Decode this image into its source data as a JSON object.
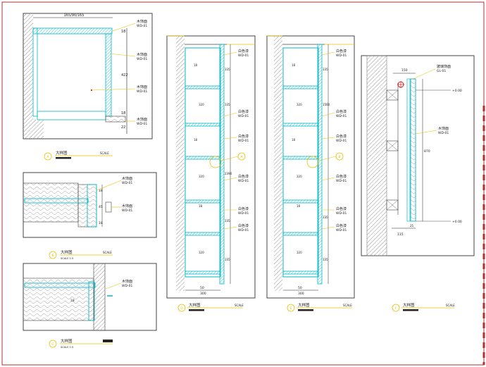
{
  "colors": {
    "border": "#b03030",
    "panel": "#444444",
    "cyan": "#00b8c8",
    "yellow": "#e8c000",
    "red": "#d00000",
    "dim": "#222222",
    "wall": "#999999"
  },
  "detail_a": {
    "top_dim": "165/90/165",
    "side_dims": [
      "18",
      "422",
      "18",
      "22"
    ],
    "notes": [
      {
        "title": "木饰面",
        "code": "WD-01"
      },
      {
        "title": "木饰面",
        "code": "WD-01"
      },
      {
        "title": "木饰面",
        "code": "WD-01"
      },
      {
        "title": "木饰面",
        "code": "WD-01"
      }
    ],
    "label": {
      "marker": "A",
      "title": "大样图",
      "scale": "SCALE"
    }
  },
  "detail_b": {
    "notes": [
      {
        "title": "木饰面",
        "code": "WD-01"
      },
      {
        "title": "木饰面",
        "code": "WD-01"
      }
    ],
    "side_dims": [
      "18",
      "45",
      "18"
    ],
    "label": {
      "marker": "B",
      "title": "大样图",
      "sub": "SCALE 1:5",
      "scale": "SCALE"
    }
  },
  "detail_c": {
    "notes": [
      {
        "title": "木饰面",
        "code": "WD-01"
      }
    ],
    "side_dims": [
      "18"
    ],
    "label": {
      "marker": "C",
      "title": "大样图",
      "sub": "SCALE 1:5",
      "scale": "SCALE"
    }
  },
  "elevation_1": {
    "shelf_dims": [
      "18",
      "320",
      "18",
      "320",
      "18",
      "320",
      "18",
      "320",
      "18",
      "320",
      "18"
    ],
    "right_dims": [
      "335",
      "335",
      "2390",
      "335",
      "335"
    ],
    "bottom_dims": [
      "50",
      "300"
    ],
    "notes": [
      {
        "title": "白色漆",
        "code": "WD-01"
      },
      {
        "title": "白色漆",
        "code": "WD-01"
      },
      {
        "title": "白色漆",
        "code": "WD-01"
      },
      {
        "title": "白色漆",
        "code": "WD-01"
      },
      {
        "title": "白色漆",
        "code": "WD-01"
      },
      {
        "title": "白色漆",
        "code": "WD-01"
      }
    ],
    "callout": "A",
    "label": {
      "marker": "D",
      "title": "大样图",
      "scale": "SCALE"
    }
  },
  "elevation_2": {
    "shelf_dims": [
      "18",
      "320",
      "18",
      "320",
      "18",
      "320",
      "18",
      "320",
      "18",
      "320",
      "18"
    ],
    "right_dims": [
      "335",
      "1560",
      "335",
      "335"
    ],
    "bottom_dims": [
      "50",
      "300"
    ],
    "notes": [
      {
        "title": "白色漆",
        "code": "WD-01"
      },
      {
        "title": "白色漆",
        "code": "WD-01"
      },
      {
        "title": "白色漆",
        "code": "WD-01"
      },
      {
        "title": "白色漆",
        "code": "WD-01"
      },
      {
        "title": "白色漆",
        "code": "WD-01"
      },
      {
        "title": "白色漆",
        "code": "WD-01"
      }
    ],
    "callout": "B",
    "label": {
      "marker": "E",
      "title": "大样图",
      "scale": "SCALE"
    }
  },
  "section_f": {
    "top_dim": "150",
    "right_dim": "870",
    "bottom_dims": [
      "115",
      "25"
    ],
    "notes": [
      {
        "title": "玻璃饰面",
        "code": "GL-01"
      },
      {
        "title": "木饰面",
        "code": "WD-01"
      }
    ],
    "levels": [
      "+0.00",
      "+0.00"
    ],
    "label": {
      "marker": "F",
      "title": "大样图",
      "scale": "SCALE"
    }
  }
}
